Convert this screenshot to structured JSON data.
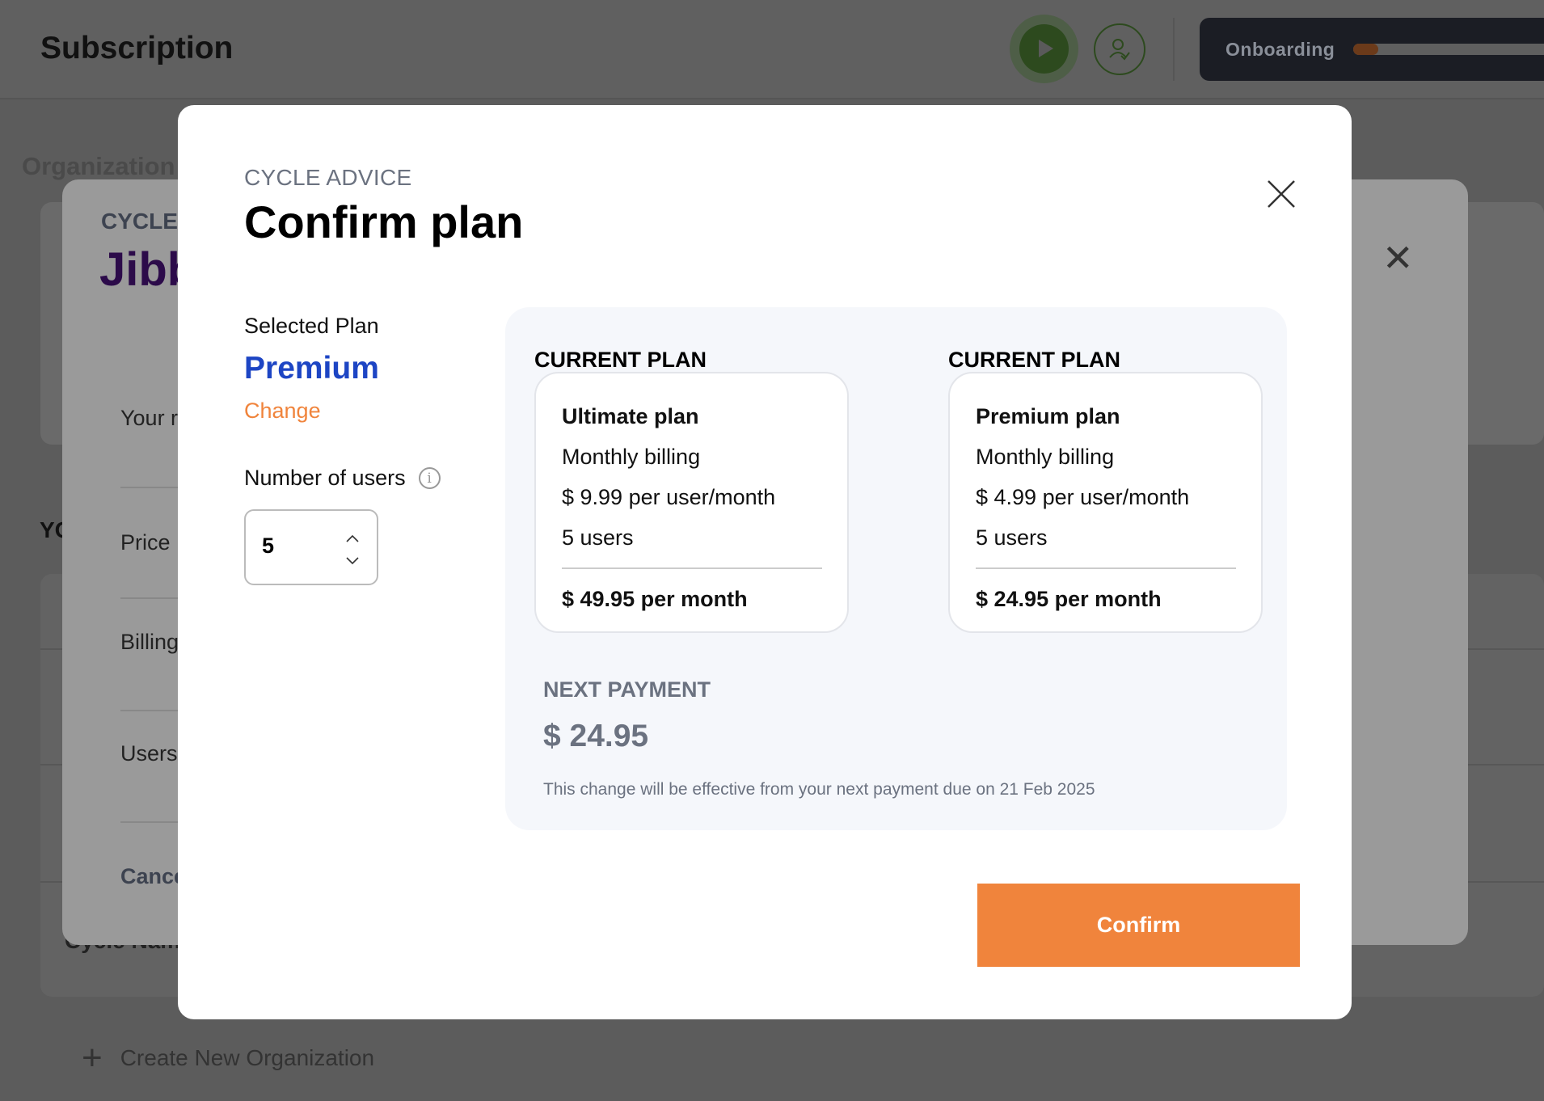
{
  "header": {
    "title": "Subscription",
    "onboarding_label": "Onboarding",
    "onboarding_progress": 0.12
  },
  "background": {
    "tab": "Organization",
    "section_heading": "YO",
    "cycle_name": "Cycle Nam",
    "create_org": "Create New Organization",
    "back_modal": {
      "eyebrow": "CYCLE",
      "title": "Jibb",
      "labels": [
        "Your r",
        "Price",
        "Billing",
        "Users",
        "Cance"
      ]
    }
  },
  "modal": {
    "eyebrow": "CYCLE ADVICE",
    "title": "Confirm plan",
    "selected_plan_label": "Selected Plan",
    "selected_plan": "Premium",
    "change_label": "Change",
    "users_label": "Number of users",
    "users_value": "5",
    "plans": [
      {
        "heading": "CURRENT PLAN",
        "name": "Ultimate plan",
        "billing": "Monthly billing",
        "price": "$ 9.99 per user/month",
        "users": "5 users",
        "total": "$ 49.95 per month"
      },
      {
        "heading": "CURRENT PLAN",
        "name": "Premium plan",
        "billing": "Monthly billing",
        "price": "$ 4.99 per user/month",
        "users": "5 users",
        "total": "$ 24.95 per month"
      }
    ],
    "next_payment_label": "NEXT PAYMENT",
    "next_payment_value": "$ 24.95",
    "note": "This change will be effective from your next payment due on 21 Feb 2025",
    "confirm_label": "Confirm"
  },
  "colors": {
    "accent": "#f0843c",
    "plan_blue": "#1d45c4",
    "muted": "#6b7280"
  }
}
